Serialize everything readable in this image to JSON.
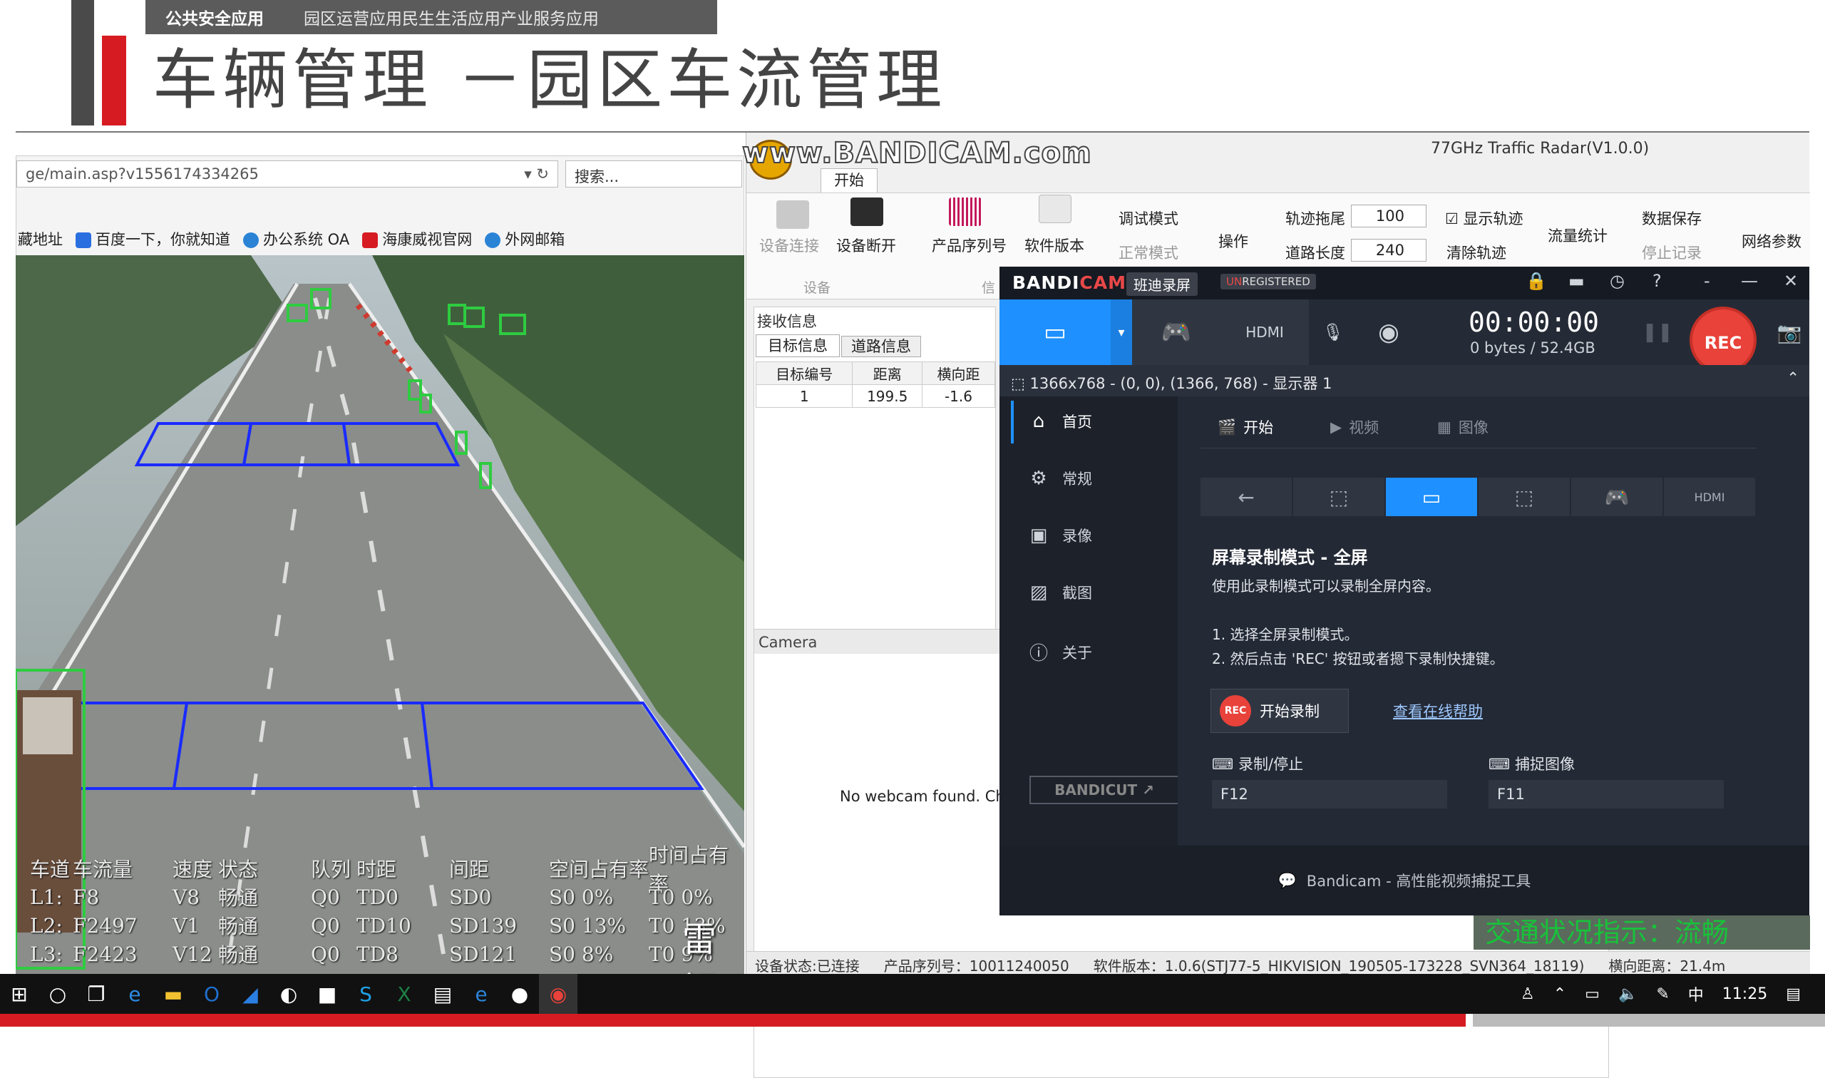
{
  "slide": {
    "strip_left": "公共安全应用",
    "strip_right": "园区运营应用民生生活应用产业服务应用",
    "title": "车辆管理 －园区车流管理"
  },
  "browser": {
    "url": "ge/main.asp?v1556174334265",
    "search_placeholder": "搜索...",
    "favorites_label": "藏地址",
    "favorites": [
      "百度一下，你就知道",
      "办公系统 OA",
      "海康威视官网",
      "外网邮箱"
    ]
  },
  "video_overlay": {
    "headers": [
      "车道",
      "车流量",
      "速度",
      "状态",
      "队列",
      "时距",
      "间距",
      "空间占有率",
      "时间占有率"
    ],
    "rows": [
      [
        "L1:",
        "F8",
        "V8",
        "畅通",
        "Q0",
        "TD0",
        "SD0",
        "S0 0%",
        "T0 0%"
      ],
      [
        "L2:",
        "F2497",
        "V1",
        "畅通",
        "Q0",
        "TD10",
        "SD139",
        "S0 13%",
        "T0 13%"
      ],
      [
        "L3:",
        "F2423",
        "V12",
        "畅通",
        "Q0",
        "TD8",
        "SD121",
        "S0 8%",
        "T0 9%"
      ]
    ],
    "watermark": "雷视"
  },
  "radar": {
    "window_title": "77GHz Traffic Radar(V1.0.0)",
    "bandicam_watermark": "www.BANDICAM.com",
    "tab": "开始",
    "ribbon": {
      "connect": "设备连接",
      "disconnect": "设备断开",
      "product_serial": "产品序列号",
      "software_version": "软件版本",
      "group_device": "设备",
      "group_info": "信",
      "debug_mode": "调试模式",
      "normal_mode": "正常模式",
      "operate": "操作",
      "trail_label": "轨迹拖尾",
      "trail_value": "100",
      "lane_len_label": "道路长度",
      "lane_len_value": "240",
      "show_trail": "显示轨迹",
      "clear_trail": "清除轨迹",
      "flow_stats": "流量统计",
      "data_save": "数据保存",
      "stop_record": "停止记录",
      "net_params": "网络参数"
    },
    "recv": {
      "header": "接收信息",
      "tab_target": "目标信息",
      "tab_lane": "道路信息",
      "columns": [
        "目标编号",
        "距离",
        "横向距"
      ],
      "rows": [
        [
          "1",
          "199.5",
          "-1.6"
        ]
      ]
    },
    "camera": {
      "header": "Camera",
      "message": "No webcam found. Ch"
    },
    "traffic_banner": "交通状况指示：流畅",
    "status": {
      "device_state": "设备状态:已连接",
      "serial": "产品序列号：10011240050",
      "software": "软件版本：1.0.6(STJ77-5_HIKVISION_190505-173228_SVN364_18119)",
      "lateral": "横向距离：21.4m"
    }
  },
  "bandicam": {
    "logo_a": "BANDI",
    "logo_b": "CAM",
    "cn_name": "班迪录屏",
    "unreg_a": "UN",
    "unreg_b": "REGISTERED",
    "timer": "00:00:00",
    "bytes": "0 bytes / 52.4GB",
    "rec_label": "REC",
    "resolution": "1366x768 - (0, 0), (1366, 768) - 显示器 1",
    "sidebar": [
      "首页",
      "常规",
      "录像",
      "截图",
      "关于"
    ],
    "bandicut": "BANDICUT ↗",
    "tabs": [
      "开始",
      "视频",
      "图像"
    ],
    "mode_title": "屏幕录制模式 - 全屏",
    "mode_desc": "使用此录制模式可以录制全屏内容。",
    "step1": "1. 选择全屏录制模式。",
    "step2": "2. 然后点击 'REC' 按钮或者摁下录制快捷键。",
    "start_rec_dot": "REC",
    "start_rec": "开始录制",
    "help_link": "查看在线帮助",
    "hotkey1_label": "录制/停止",
    "hotkey1": "F12",
    "hotkey2_label": "捕捉图像",
    "hotkey2": "F11",
    "footer": "Bandicam - 高性能视频捕捉工具"
  },
  "taskbar": {
    "ime": "中",
    "time": "11:25"
  },
  "colors": {
    "accent_red": "#d61c22",
    "bandicam_blue": "#1e90ff",
    "rec_red": "#e8423a",
    "detect_box_green": "#2ecc40",
    "lane_zone_blue": "#1a2bff"
  }
}
